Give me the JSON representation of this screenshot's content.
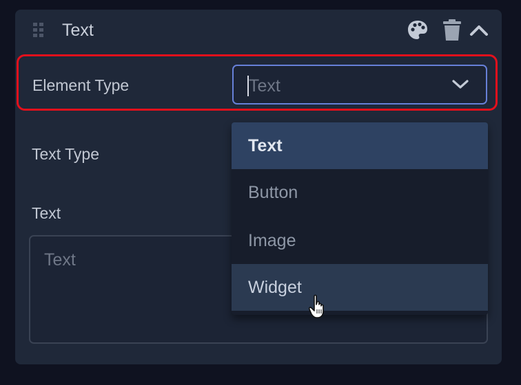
{
  "panel": {
    "title": "Text",
    "icons": [
      "drag-handle-icon",
      "palette-icon",
      "trash-icon",
      "chevron-up-icon"
    ]
  },
  "fields": {
    "element_type": {
      "label": "Element Type",
      "value": "Text",
      "selected": "Text",
      "options": [
        "Text",
        "Button",
        "Image",
        "Widget"
      ],
      "hovered_option": "Widget"
    },
    "text_type": {
      "label": "Text Type"
    },
    "text": {
      "label": "Text",
      "placeholder": "Text"
    }
  },
  "colors": {
    "highlight": "#e3101c",
    "focus_border": "#6780d8",
    "selected_option_bg": "#2e4262",
    "hovered_option_bg": "#2b3a51"
  }
}
